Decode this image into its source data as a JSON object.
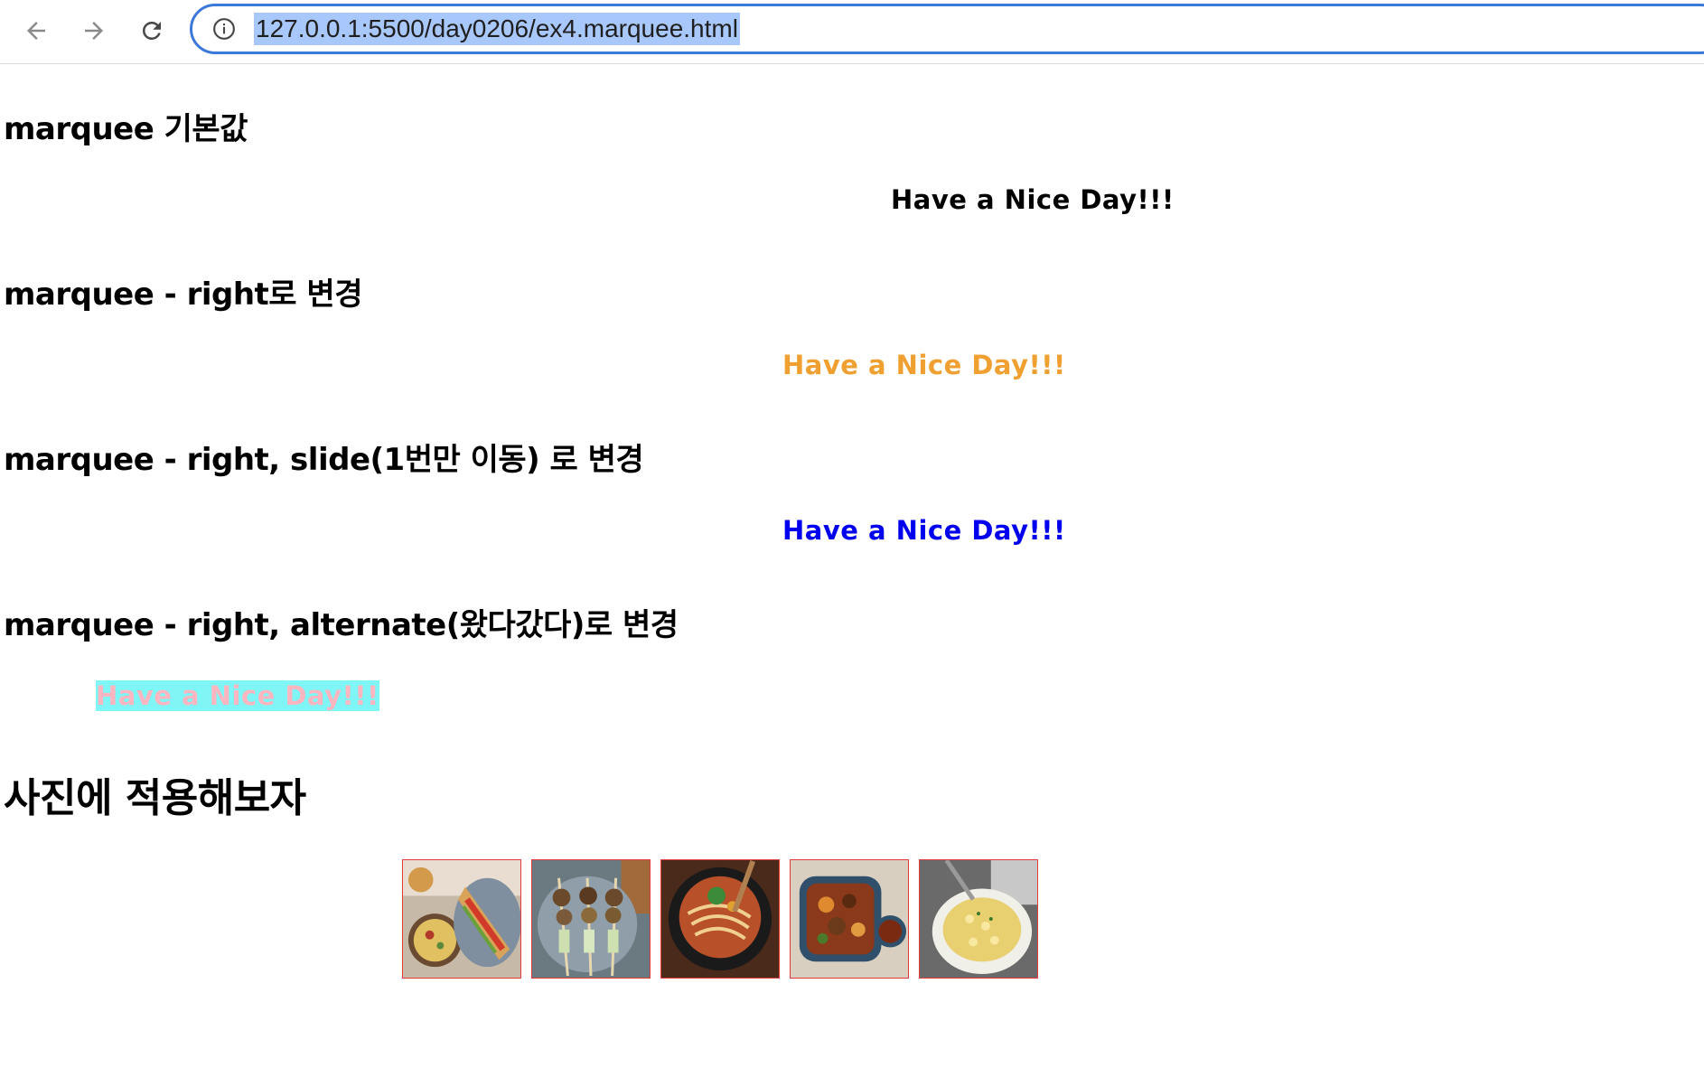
{
  "browser": {
    "url": "127.0.0.1:5500/day0206/ex4.marquee.html"
  },
  "sections": [
    {
      "heading": "marquee 기본값",
      "marquee_text": "Have a Nice Day!!!",
      "color": "#000000"
    },
    {
      "heading": "marquee - right로 변경",
      "marquee_text": "Have a Nice Day!!!",
      "color": "#f0a030"
    },
    {
      "heading": "marquee - right, slide(1번만 이동) 로 변경",
      "marquee_text": "Have a Nice Day!!!",
      "color": "#0000ee"
    },
    {
      "heading": "marquee - right, alternate(왔다갔다)로 변경",
      "marquee_text": "Have a Nice Day!!!",
      "color": "#ffb6c1",
      "background": "#7ff5f5"
    }
  ],
  "photo_section": {
    "heading": "사진에 적용해보자",
    "photos": [
      {
        "name": "sandwich-photo"
      },
      {
        "name": "skewer-photo"
      },
      {
        "name": "noodle-soup-photo"
      },
      {
        "name": "stew-photo"
      },
      {
        "name": "mac-and-cheese-photo"
      }
    ]
  }
}
